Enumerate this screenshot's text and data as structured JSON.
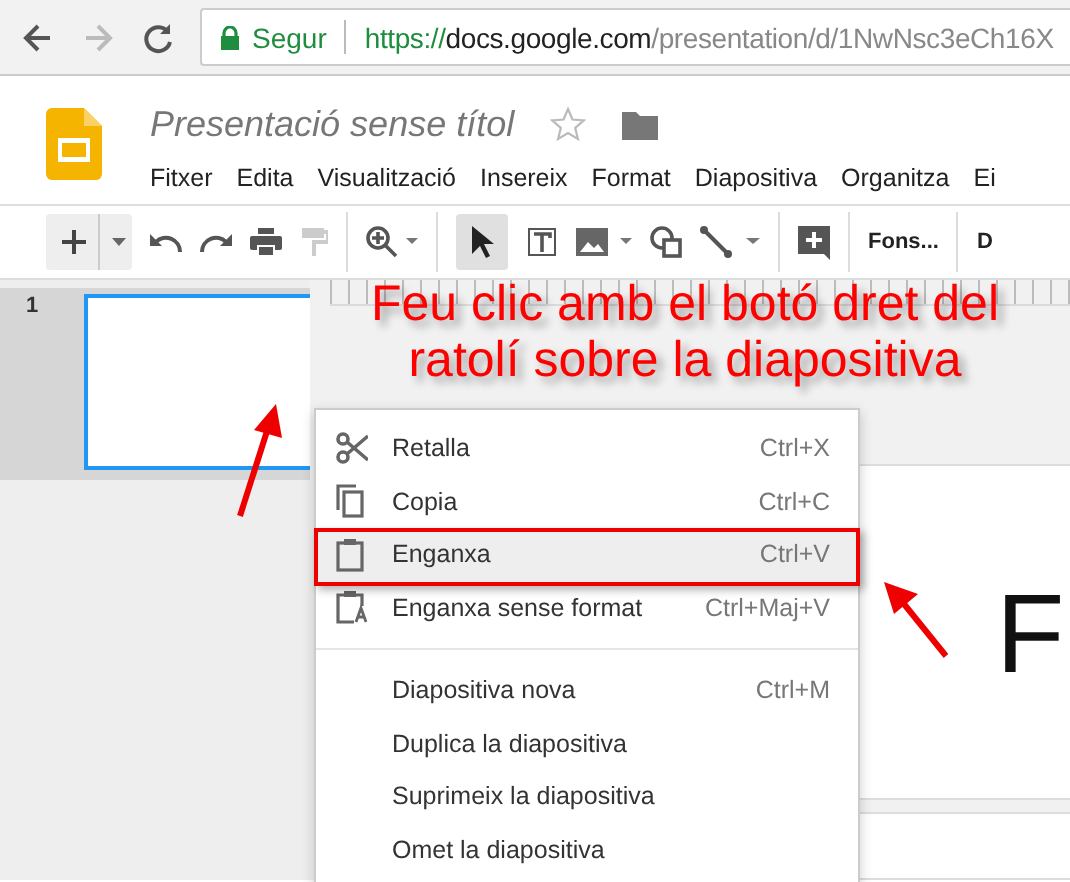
{
  "browser": {
    "security": "Segur",
    "url": {
      "scheme": "https://",
      "domain": "docs.google.com",
      "path": "/presentation/d/1NwNsc3eCh16X"
    }
  },
  "document": {
    "title": "Presentació sense títol",
    "starred": false
  },
  "menu_bar": [
    "Fitxer",
    "Edita",
    "Visualització",
    "Insereix",
    "Format",
    "Diapositiva",
    "Organitza",
    "Ei"
  ],
  "toolbar": {
    "background_button": "Fons...",
    "cut_label": "D"
  },
  "filmstrip": [
    {
      "number": "1",
      "selected": true
    }
  ],
  "slide": {
    "title_fragment": "F"
  },
  "context_menu": [
    {
      "kind": "cut",
      "label": "Retalla",
      "shortcut": "Ctrl+X",
      "selected": false
    },
    {
      "kind": "copy",
      "label": "Copia",
      "shortcut": "Ctrl+C",
      "selected": false
    },
    {
      "kind": "paste",
      "label": "Enganxa",
      "shortcut": "Ctrl+V",
      "selected": true
    },
    {
      "kind": "pastetext",
      "label": "Enganxa sense format",
      "shortcut": "Ctrl+Maj+V",
      "selected": false
    },
    {
      "kind": "separator"
    },
    {
      "kind": "item",
      "label": "Diapositiva nova",
      "shortcut": "Ctrl+M",
      "selected": false
    },
    {
      "kind": "item",
      "label": "Duplica la diapositiva",
      "selected": false
    },
    {
      "kind": "item",
      "label": "Suprimeix la diapositiva",
      "selected": false
    },
    {
      "kind": "item",
      "label": "Omet la diapositiva",
      "selected": false
    }
  ],
  "annotation": {
    "lines": [
      "Feu clic amb el botó dret del",
      "ratolí sobre la diapositiva"
    ]
  }
}
